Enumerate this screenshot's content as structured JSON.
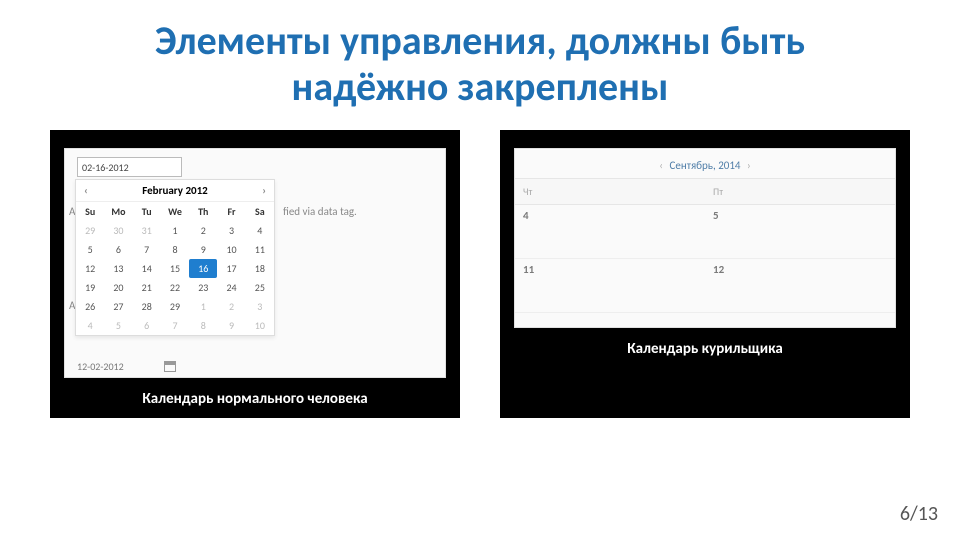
{
  "title_line1": "Элементы управления, должны быть",
  "title_line2": "надёжно закреплены",
  "page_indicator": "6/13",
  "left": {
    "caption": "Календарь нормального человека",
    "input_value": "02-16-2012",
    "month_label": "February 2012",
    "bg_hint": "fied via data tag.",
    "bg_prefix": "Atta",
    "bg_label2": "Ad",
    "dow": [
      "Su",
      "Mo",
      "Tu",
      "We",
      "Th",
      "Fr",
      "Sa"
    ],
    "weeks": [
      [
        {
          "v": "29",
          "m": true
        },
        {
          "v": "30",
          "m": true
        },
        {
          "v": "31",
          "m": true
        },
        {
          "v": "1"
        },
        {
          "v": "2"
        },
        {
          "v": "3"
        },
        {
          "v": "4"
        }
      ],
      [
        {
          "v": "5"
        },
        {
          "v": "6"
        },
        {
          "v": "7"
        },
        {
          "v": "8"
        },
        {
          "v": "9"
        },
        {
          "v": "10"
        },
        {
          "v": "11"
        }
      ],
      [
        {
          "v": "12"
        },
        {
          "v": "13"
        },
        {
          "v": "14"
        },
        {
          "v": "15"
        },
        {
          "v": "16",
          "sel": true
        },
        {
          "v": "17"
        },
        {
          "v": "18"
        }
      ],
      [
        {
          "v": "19"
        },
        {
          "v": "20"
        },
        {
          "v": "21"
        },
        {
          "v": "22"
        },
        {
          "v": "23"
        },
        {
          "v": "24"
        },
        {
          "v": "25"
        }
      ],
      [
        {
          "v": "26"
        },
        {
          "v": "27"
        },
        {
          "v": "28"
        },
        {
          "v": "29"
        },
        {
          "v": "1",
          "m": true
        },
        {
          "v": "2",
          "m": true
        },
        {
          "v": "3",
          "m": true
        }
      ],
      [
        {
          "v": "4",
          "m": true
        },
        {
          "v": "5",
          "m": true
        },
        {
          "v": "6",
          "m": true
        },
        {
          "v": "7",
          "m": true
        },
        {
          "v": "8",
          "m": true
        },
        {
          "v": "9",
          "m": true
        },
        {
          "v": "10",
          "m": true
        }
      ]
    ],
    "bottom_date": "12-02-2012"
  },
  "right": {
    "caption": "Календарь курильщика",
    "month_label": "Сентябрь, 2014",
    "dow": [
      "Чт",
      "Пт"
    ],
    "rows": [
      [
        "4",
        "5"
      ],
      [
        "11",
        "12"
      ]
    ]
  }
}
